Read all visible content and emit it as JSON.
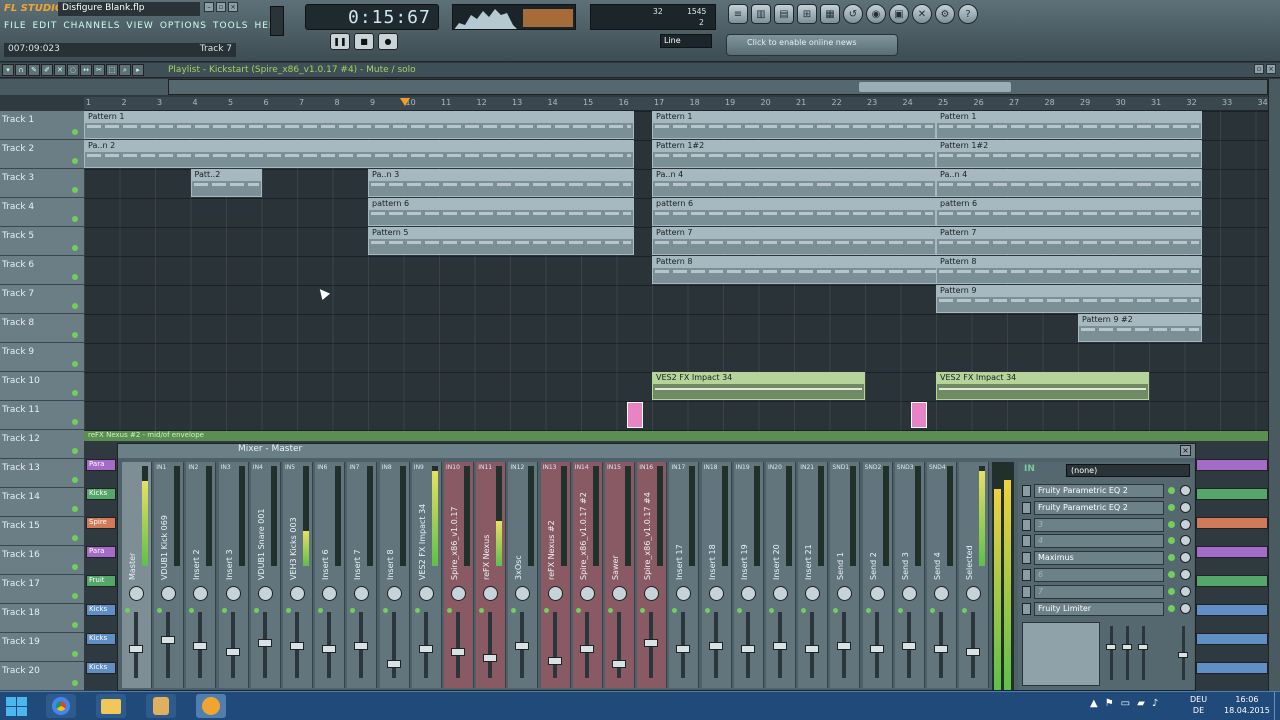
{
  "app": {
    "brand": "FL STUDIO",
    "file_title": "Disfigure Blank.flp",
    "menu": [
      "FILE",
      "EDIT",
      "CHANNELS",
      "VIEW",
      "OPTIONS",
      "TOOLS",
      "HELP"
    ],
    "hint_time": "007:09:023",
    "hint_target": "Track 7",
    "song_time": "0:15:67",
    "cpu_mem": "32",
    "cpu_voices": "1545",
    "cpu_poly": "2",
    "snap_value": "Line",
    "news_text": "Click to enable online news"
  },
  "playlist": {
    "title": "Playlist - Kickstart (Spire_x86_v1.0.17 #4) - Mute / solo",
    "bars": [
      "1",
      "2",
      "3",
      "4",
      "5",
      "6",
      "7",
      "8",
      "9",
      "10",
      "11",
      "12",
      "13",
      "14",
      "15",
      "16",
      "17",
      "18",
      "19",
      "20",
      "21",
      "22",
      "23",
      "24",
      "25",
      "26",
      "27",
      "28",
      "29",
      "30",
      "31",
      "32",
      "33",
      "34"
    ],
    "tracks": [
      "Track 1",
      "Track 2",
      "Track 3",
      "Track 4",
      "Track 5",
      "Track 6",
      "Track 7",
      "Track 8",
      "Track 9",
      "Track 10",
      "Track 11",
      "Track 12",
      "Track 13",
      "Track 14",
      "Track 15",
      "Track 16",
      "Track 17",
      "Track 18",
      "Track 19",
      "Track 20"
    ],
    "track12_clip": "reFX Nexus #2 - mid/of envelope",
    "clips": [
      {
        "track": 1,
        "start": 1,
        "end": 16.5,
        "label": "Pattern 1"
      },
      {
        "track": 1,
        "start": 17,
        "end": 25,
        "label": "Pattern 1"
      },
      {
        "track": 1,
        "start": 25,
        "end": 32.5,
        "label": "Pattern 1"
      },
      {
        "track": 2,
        "start": 1,
        "end": 16.5,
        "label": "Pa..n 2"
      },
      {
        "track": 2,
        "start": 17,
        "end": 25,
        "label": "Pattern 1#2"
      },
      {
        "track": 2,
        "start": 25,
        "end": 32.5,
        "label": "Pattern 1#2"
      },
      {
        "track": 3,
        "start": 4,
        "end": 6,
        "label": "Patt..2"
      },
      {
        "track": 3,
        "start": 9,
        "end": 16.5,
        "label": "Pa..n 3"
      },
      {
        "track": 3,
        "start": 17,
        "end": 25,
        "label": "Pa..n 4"
      },
      {
        "track": 3,
        "start": 25,
        "end": 32.5,
        "label": "Pa..n 4"
      },
      {
        "track": 4,
        "start": 9,
        "end": 16.5,
        "label": "pattern 6"
      },
      {
        "track": 4,
        "start": 17,
        "end": 25,
        "label": "pattern 6"
      },
      {
        "track": 4,
        "start": 25,
        "end": 32.5,
        "label": "pattern 6"
      },
      {
        "track": 5,
        "start": 9,
        "end": 16.5,
        "label": "Pattern 5"
      },
      {
        "track": 5,
        "start": 17,
        "end": 25,
        "label": "Pattern 7"
      },
      {
        "track": 5,
        "start": 25,
        "end": 32.5,
        "label": "Pattern 7"
      },
      {
        "track": 6,
        "start": 17,
        "end": 25.25,
        "label": "Pattern 8"
      },
      {
        "track": 6,
        "start": 25,
        "end": 32.5,
        "label": "Pattern 8"
      },
      {
        "track": 7,
        "start": 25,
        "end": 32.5,
        "label": "Pattern 9"
      },
      {
        "track": 8,
        "start": 29,
        "end": 32.5,
        "label": "Pattern 9 #2"
      },
      {
        "track": 10,
        "start": 17,
        "end": 23,
        "label": "VES2 FX Impact 34",
        "audio": true
      },
      {
        "track": 10,
        "start": 25,
        "end": 31,
        "label": "VES2 FX Impact 34",
        "audio": true
      }
    ]
  },
  "mixer": {
    "title": "Mixer - Master",
    "channels": [
      {
        "name": "Master",
        "tag": "",
        "level": 0.85,
        "color": "master"
      },
      {
        "name": "VDUB1 Kick 069",
        "tag": "IN1",
        "level": 0.0,
        "color": ""
      },
      {
        "name": "Insert 2",
        "tag": "IN2",
        "level": 0.0,
        "color": ""
      },
      {
        "name": "Insert 3",
        "tag": "IN3",
        "level": 0.0,
        "color": ""
      },
      {
        "name": "VDUB1 Snare 001",
        "tag": "IN4",
        "level": 0.0,
        "color": ""
      },
      {
        "name": "VEH3 Kicks 003",
        "tag": "IN5",
        "level": 0.35,
        "color": ""
      },
      {
        "name": "Insert 6",
        "tag": "IN6",
        "level": 0.0,
        "color": ""
      },
      {
        "name": "Insert 7",
        "tag": "IN7",
        "level": 0.0,
        "color": ""
      },
      {
        "name": "Insert 8",
        "tag": "IN8",
        "level": 0.0,
        "color": ""
      },
      {
        "name": "VES2 FX Impact 34",
        "tag": "IN9",
        "level": 0.95,
        "color": ""
      },
      {
        "name": "Spire_x86_v1.0.17",
        "tag": "IN10",
        "level": 0.0,
        "color": "red"
      },
      {
        "name": "reFX Nexus",
        "tag": "IN11",
        "level": 0.45,
        "color": "red"
      },
      {
        "name": "3xOsc",
        "tag": "IN12",
        "level": 0.0,
        "color": ""
      },
      {
        "name": "reFX Nexus #2",
        "tag": "IN13",
        "level": 0.0,
        "color": "red"
      },
      {
        "name": "Spire_x86_v1.0.17 #2",
        "tag": "IN14",
        "level": 0.0,
        "color": "red"
      },
      {
        "name": "Sawer",
        "tag": "IN15",
        "level": 0.0,
        "color": "red"
      },
      {
        "name": "Spire_x86_v1.0.17 #4",
        "tag": "IN16",
        "level": 0.0,
        "color": "red"
      },
      {
        "name": "Insert 17",
        "tag": "IN17",
        "level": 0.0,
        "color": ""
      },
      {
        "name": "Insert 18",
        "tag": "IN18",
        "level": 0.0,
        "color": ""
      },
      {
        "name": "Insert 19",
        "tag": "IN19",
        "level": 0.0,
        "color": ""
      },
      {
        "name": "Insert 20",
        "tag": "IN20",
        "level": 0.0,
        "color": ""
      },
      {
        "name": "Insert 21",
        "tag": "IN21",
        "level": 0.0,
        "color": ""
      },
      {
        "name": "Send 1",
        "tag": "SND1",
        "level": 0.0,
        "color": ""
      },
      {
        "name": "Send 2",
        "tag": "SND2",
        "level": 0.0,
        "color": ""
      },
      {
        "name": "Send 3",
        "tag": "SND3",
        "level": 0.0,
        "color": ""
      },
      {
        "name": "Send 4",
        "tag": "SND4",
        "level": 0.0,
        "color": ""
      },
      {
        "name": "Selected",
        "tag": "",
        "level": 0.95,
        "color": ""
      }
    ],
    "fx": {
      "input_label": "IN",
      "input_value": "(none)",
      "slots": [
        "Fruity Parametric EQ 2",
        "Fruity Parametric EQ 2",
        "3",
        "4",
        "Maximus",
        "6",
        "7",
        "Fruity Limiter"
      ]
    }
  },
  "playlist_left_clips": [
    "Para",
    "Kicks",
    "Spire",
    "Para",
    "Fruit",
    "Kicks",
    "Kicks",
    "Kicks"
  ],
  "taskbar": {
    "lang": "DEU",
    "lang_sub": "DE",
    "time": "16:06",
    "date": "18.04.2015"
  },
  "colors": {
    "accent": "#9fd45a",
    "clip": "#7b8f97",
    "clip_header": "#a7b9c0",
    "audio_clip": "#b5d49a",
    "meter": "#5ec04a",
    "playhead": "#f0a020"
  }
}
